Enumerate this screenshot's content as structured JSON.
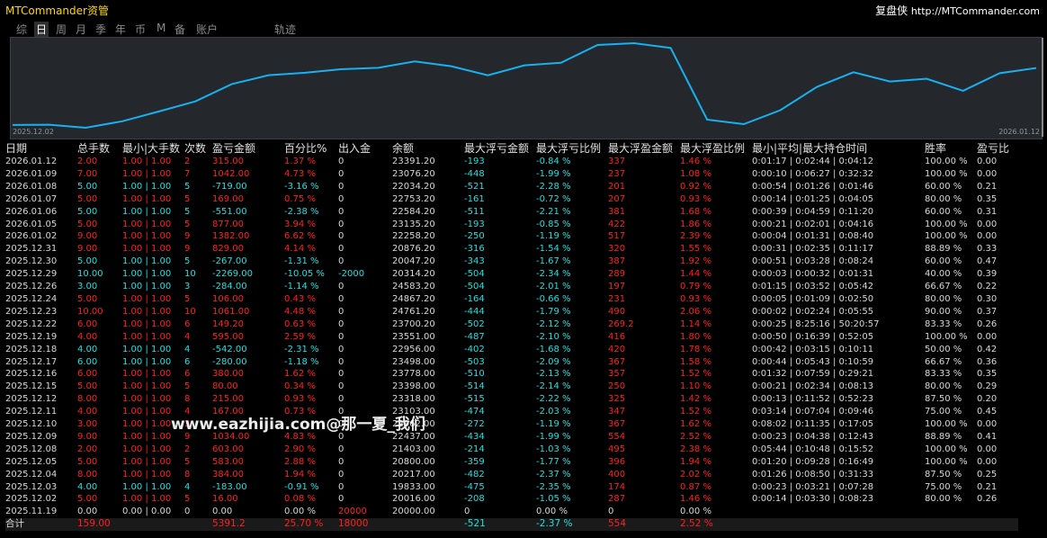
{
  "app": {
    "title": "MTCommander资管",
    "brand": "复盘侠",
    "url": "http://MTCommander.com"
  },
  "tabs": [
    "综",
    "日",
    "周",
    "月",
    "季",
    "年",
    "币",
    "M",
    "备",
    "账户",
    "轨迹"
  ],
  "active_tab": "日",
  "equity_chart": {
    "start_label": "2025.12.02",
    "end_label": "2026.01.12",
    "line_color": "#1ab0ef",
    "balances": [
      20000,
      20016,
      19833,
      20217,
      20800,
      21403,
      22437,
      22962,
      23103,
      23318,
      23398,
      23778,
      23498,
      22956,
      23551,
      23700,
      24761,
      24867,
      24583,
      20314,
      20047,
      20876,
      22258,
      23135,
      22584,
      22753,
      22034,
      23076,
      23391
    ]
  },
  "table": {
    "headers": [
      "日期",
      "总手数",
      "最小|大手数",
      "次数",
      "盈亏金额",
      "百分比%",
      "出入金",
      "余额",
      "最大浮亏金额",
      "最大浮亏比例",
      "最大浮盈金额",
      "最大浮盈比例",
      "最小|平均|最大持仓时间",
      "胜率",
      "盈亏比"
    ],
    "rows": [
      {
        "date": "2026.01.12",
        "lots": "2.00",
        "minmax": "1.00 | 1.00",
        "count": "2",
        "pnl": "315.00",
        "pct": "1.37 %",
        "flow": "0",
        "bal": "23391.20",
        "mfl": "-193",
        "mflp": "-0.84 %",
        "mfp": "337",
        "mfpp": "1.46 %",
        "time": "0:01:17 | 0:02:44 | 0:04:12",
        "win": "100.00 %",
        "pr": "0.00",
        "c": "R"
      },
      {
        "date": "2026.01.09",
        "lots": "7.00",
        "minmax": "1.00 | 1.00",
        "count": "7",
        "pnl": "1042.00",
        "pct": "4.73 %",
        "flow": "0",
        "bal": "23076.20",
        "mfl": "-448",
        "mflp": "-1.99 %",
        "mfp": "237",
        "mfpp": "1.08 %",
        "time": "0:00:10 | 0:06:27 | 0:32:32",
        "win": "100.00 %",
        "pr": "0.00",
        "c": "R"
      },
      {
        "date": "2026.01.08",
        "lots": "5.00",
        "minmax": "1.00 | 1.00",
        "count": "5",
        "pnl": "-719.00",
        "pct": "-3.16 %",
        "flow": "0",
        "bal": "22034.20",
        "mfl": "-521",
        "mflp": "-2.28 %",
        "mfp": "201",
        "mfpp": "0.92 %",
        "time": "0:00:54 | 0:01:26 | 0:01:46",
        "win": "60.00 %",
        "pr": "0.21",
        "c": "C"
      },
      {
        "date": "2026.01.07",
        "lots": "5.00",
        "minmax": "1.00 | 1.00",
        "count": "5",
        "pnl": "169.00",
        "pct": "0.75 %",
        "flow": "0",
        "bal": "22753.20",
        "mfl": "-161",
        "mflp": "-0.72 %",
        "mfp": "207",
        "mfpp": "0.93 %",
        "time": "0:00:14 | 0:01:25 | 0:04:05",
        "win": "80.00 %",
        "pr": "0.35",
        "c": "R"
      },
      {
        "date": "2026.01.06",
        "lots": "5.00",
        "minmax": "1.00 | 1.00",
        "count": "5",
        "pnl": "-551.00",
        "pct": "-2.38 %",
        "flow": "0",
        "bal": "22584.20",
        "mfl": "-511",
        "mflp": "-2.21 %",
        "mfp": "381",
        "mfpp": "1.68 %",
        "time": "0:00:39 | 0:04:59 | 0:11:20",
        "win": "60.00 %",
        "pr": "0.31",
        "c": "C"
      },
      {
        "date": "2026.01.05",
        "lots": "5.00",
        "minmax": "1.00 | 1.00",
        "count": "5",
        "pnl": "877.00",
        "pct": "3.94 %",
        "flow": "0",
        "bal": "23135.20",
        "mfl": "-193",
        "mflp": "-0.85 %",
        "mfp": "422",
        "mfpp": "1.86 %",
        "time": "0:00:21 | 0:02:01 | 0:04:16",
        "win": "100.00 %",
        "pr": "0.00",
        "c": "R"
      },
      {
        "date": "2026.01.02",
        "lots": "9.00",
        "minmax": "1.00 | 1.00",
        "count": "9",
        "pnl": "1382.00",
        "pct": "6.62 %",
        "flow": "0",
        "bal": "22258.20",
        "mfl": "-250",
        "mflp": "-1.19 %",
        "mfp": "517",
        "mfpp": "2.39 %",
        "time": "0:00:04 | 0:01:31 | 0:08:40",
        "win": "100.00 %",
        "pr": "0.00",
        "c": "R"
      },
      {
        "date": "2025.12.31",
        "lots": "9.00",
        "minmax": "1.00 | 1.00",
        "count": "9",
        "pnl": "829.00",
        "pct": "4.14 %",
        "flow": "0",
        "bal": "20876.20",
        "mfl": "-316",
        "mflp": "-1.54 %",
        "mfp": "320",
        "mfpp": "1.55 %",
        "time": "0:00:31 | 0:02:35 | 0:11:17",
        "win": "88.89 %",
        "pr": "0.33",
        "c": "R"
      },
      {
        "date": "2025.12.30",
        "lots": "5.00",
        "minmax": "1.00 | 1.00",
        "count": "5",
        "pnl": "-267.00",
        "pct": "-1.31 %",
        "flow": "0",
        "bal": "20047.20",
        "mfl": "-343",
        "mflp": "-1.67 %",
        "mfp": "387",
        "mfpp": "1.92 %",
        "time": "0:00:51 | 0:03:28 | 0:08:24",
        "win": "60.00 %",
        "pr": "0.47",
        "c": "C"
      },
      {
        "date": "2025.12.29",
        "lots": "10.00",
        "minmax": "1.00 | 1.00",
        "count": "10",
        "pnl": "-2269.00",
        "pct": "-10.05 %",
        "flow": "-2000",
        "bal": "20314.20",
        "mfl": "-504",
        "mflp": "-2.34 %",
        "mfp": "289",
        "mfpp": "1.44 %",
        "time": "0:00:03 | 0:00:32 | 0:01:31",
        "win": "40.00 %",
        "pr": "0.39",
        "c": "C"
      },
      {
        "date": "2025.12.26",
        "lots": "3.00",
        "minmax": "1.00 | 1.00",
        "count": "3",
        "pnl": "-284.00",
        "pct": "-1.14 %",
        "flow": "0",
        "bal": "24583.20",
        "mfl": "-504",
        "mflp": "-2.01 %",
        "mfp": "197",
        "mfpp": "0.79 %",
        "time": "0:01:15 | 0:03:52 | 0:05:42",
        "win": "66.67 %",
        "pr": "0.22",
        "c": "C"
      },
      {
        "date": "2025.12.24",
        "lots": "5.00",
        "minmax": "1.00 | 1.00",
        "count": "5",
        "pnl": "106.00",
        "pct": "0.43 %",
        "flow": "0",
        "bal": "24867.20",
        "mfl": "-164",
        "mflp": "-0.66 %",
        "mfp": "231",
        "mfpp": "0.93 %",
        "time": "0:00:05 | 0:01:09 | 0:02:50",
        "win": "80.00 %",
        "pr": "0.30",
        "c": "R"
      },
      {
        "date": "2025.12.23",
        "lots": "10.00",
        "minmax": "1.00 | 1.00",
        "count": "10",
        "pnl": "1061.00",
        "pct": "4.48 %",
        "flow": "0",
        "bal": "24761.20",
        "mfl": "-444",
        "mflp": "-1.79 %",
        "mfp": "490",
        "mfpp": "2.06 %",
        "time": "0:00:02 | 0:02:24 | 0:05:55",
        "win": "90.00 %",
        "pr": "0.37",
        "c": "R"
      },
      {
        "date": "2025.12.22",
        "lots": "6.00",
        "minmax": "1.00 | 1.00",
        "count": "6",
        "pnl": "149.20",
        "pct": "0.63 %",
        "flow": "0",
        "bal": "23700.20",
        "mfl": "-502",
        "mflp": "-2.12 %",
        "mfp": "269.2",
        "mfpp": "1.14 %",
        "time": "0:00:25 | 8:25:16 | 50:20:57",
        "win": "83.33 %",
        "pr": "0.26",
        "c": "R"
      },
      {
        "date": "2025.12.19",
        "lots": "4.00",
        "minmax": "1.00 | 1.00",
        "count": "4",
        "pnl": "595.00",
        "pct": "2.59 %",
        "flow": "0",
        "bal": "23551.00",
        "mfl": "-487",
        "mflp": "-2.10 %",
        "mfp": "416",
        "mfpp": "1.80 %",
        "time": "0:00:50 | 0:16:39 | 0:52:05",
        "win": "100.00 %",
        "pr": "0.00",
        "c": "R"
      },
      {
        "date": "2025.12.18",
        "lots": "4.00",
        "minmax": "1.00 | 1.00",
        "count": "4",
        "pnl": "-542.00",
        "pct": "-2.31 %",
        "flow": "0",
        "bal": "22956.00",
        "mfl": "-402",
        "mflp": "-1.68 %",
        "mfp": "420",
        "mfpp": "1.78 %",
        "time": "0:00:42 | 0:03:15 | 0:10:11",
        "win": "50.00 %",
        "pr": "0.42",
        "c": "C"
      },
      {
        "date": "2025.12.17",
        "lots": "6.00",
        "minmax": "1.00 | 1.00",
        "count": "6",
        "pnl": "-280.00",
        "pct": "-1.18 %",
        "flow": "0",
        "bal": "23498.00",
        "mfl": "-503",
        "mflp": "-2.09 %",
        "mfp": "367",
        "mfpp": "1.58 %",
        "time": "0:00:44 | 0:05:43 | 0:10:59",
        "win": "66.67 %",
        "pr": "0.36",
        "c": "C"
      },
      {
        "date": "2025.12.16",
        "lots": "6.00",
        "minmax": "1.00 | 1.00",
        "count": "6",
        "pnl": "380.00",
        "pct": "1.62 %",
        "flow": "0",
        "bal": "23778.00",
        "mfl": "-510",
        "mflp": "-2.13 %",
        "mfp": "357",
        "mfpp": "1.52 %",
        "time": "0:01:32 | 0:07:59 | 0:29:21",
        "win": "83.33 %",
        "pr": "0.35",
        "c": "R"
      },
      {
        "date": "2025.12.15",
        "lots": "5.00",
        "minmax": "1.00 | 1.00",
        "count": "5",
        "pnl": "80.00",
        "pct": "0.34 %",
        "flow": "0",
        "bal": "23398.00",
        "mfl": "-514",
        "mflp": "-2.14 %",
        "mfp": "250",
        "mfpp": "1.10 %",
        "time": "0:00:21 | 0:02:34 | 0:08:13",
        "win": "80.00 %",
        "pr": "0.29",
        "c": "R"
      },
      {
        "date": "2025.12.12",
        "lots": "8.00",
        "minmax": "1.00 | 1.00",
        "count": "8",
        "pnl": "215.00",
        "pct": "0.93 %",
        "flow": "0",
        "bal": "23318.00",
        "mfl": "-515",
        "mflp": "-2.22 %",
        "mfp": "325",
        "mfpp": "1.42 %",
        "time": "0:00:13 | 0:11:52 | 0:52:23",
        "win": "87.50 %",
        "pr": "0.20",
        "c": "R"
      },
      {
        "date": "2025.12.11",
        "lots": "4.00",
        "minmax": "1.00 | 1.00",
        "count": "4",
        "pnl": "167.00",
        "pct": "0.73 %",
        "flow": "0",
        "bal": "23103.00",
        "mfl": "-474",
        "mflp": "-2.03 %",
        "mfp": "347",
        "mfpp": "1.52 %",
        "time": "0:03:14 | 0:07:04 | 0:09:46",
        "win": "75.00 %",
        "pr": "0.45",
        "c": "R"
      },
      {
        "date": "2025.12.10",
        "lots": "3.00",
        "minmax": "1.00 | 1.00",
        "count": "3",
        "pnl": "",
        "pct": "",
        "flow": "0",
        "bal": "22962.00",
        "mfl": "-272",
        "mflp": "-1.19 %",
        "mfp": "367",
        "mfpp": "1.62 %",
        "time": "0:08:02 | 0:11:35 | 0:17:05",
        "win": "100.00 %",
        "pr": "0.00",
        "c": "R"
      },
      {
        "date": "2025.12.09",
        "lots": "9.00",
        "minmax": "1.00 | 1.00",
        "count": "9",
        "pnl": "1034.00",
        "pct": "4.83 %",
        "flow": "0",
        "bal": "22437.00",
        "mfl": "-434",
        "mflp": "-1.99 %",
        "mfp": "554",
        "mfpp": "2.52 %",
        "time": "0:00:23 | 0:04:38 | 0:12:43",
        "win": "88.89 %",
        "pr": "0.41",
        "c": "R"
      },
      {
        "date": "2025.12.08",
        "lots": "2.00",
        "minmax": "1.00 | 1.00",
        "count": "2",
        "pnl": "603.00",
        "pct": "2.90 %",
        "flow": "0",
        "bal": "21403.00",
        "mfl": "-214",
        "mflp": "-1.03 %",
        "mfp": "495",
        "mfpp": "2.38 %",
        "time": "0:05:44 | 0:10:48 | 0:15:52",
        "win": "100.00 %",
        "pr": "0.00",
        "c": "R"
      },
      {
        "date": "2025.12.05",
        "lots": "5.00",
        "minmax": "1.00 | 1.00",
        "count": "5",
        "pnl": "583.00",
        "pct": "2.88 %",
        "flow": "0",
        "bal": "20800.00",
        "mfl": "-359",
        "mflp": "-1.77 %",
        "mfp": "396",
        "mfpp": "1.94 %",
        "time": "0:01:20 | 0:09:28 | 0:16:49",
        "win": "100.00 %",
        "pr": "0.00",
        "c": "R"
      },
      {
        "date": "2025.12.04",
        "lots": "8.00",
        "minmax": "1.00 | 1.00",
        "count": "8",
        "pnl": "384.00",
        "pct": "1.94 %",
        "flow": "0",
        "bal": "20217.00",
        "mfl": "-482",
        "mflp": "-2.37 %",
        "mfp": "400",
        "mfpp": "2.02 %",
        "time": "0:01:26 | 0:08:50 | 0:31:33",
        "win": "87.50 %",
        "pr": "0.25",
        "c": "R"
      },
      {
        "date": "2025.12.03",
        "lots": "4.00",
        "minmax": "1.00 | 1.00",
        "count": "4",
        "pnl": "-183.00",
        "pct": "-0.91 %",
        "flow": "0",
        "bal": "19833.00",
        "mfl": "-475",
        "mflp": "-2.35 %",
        "mfp": "174",
        "mfpp": "0.87 %",
        "time": "0:00:23 | 0:03:21 | 0:07:28",
        "win": "75.00 %",
        "pr": "0.21",
        "c": "C"
      },
      {
        "date": "2025.12.02",
        "lots": "5.00",
        "minmax": "1.00 | 1.00",
        "count": "5",
        "pnl": "16.00",
        "pct": "0.08 %",
        "flow": "0",
        "bal": "20016.00",
        "mfl": "-208",
        "mflp": "-1.05 %",
        "mfp": "287",
        "mfpp": "1.46 %",
        "time": "0:00:14 | 0:03:30 | 0:08:23",
        "win": "80.00 %",
        "pr": "0.26",
        "c": "R"
      },
      {
        "date": "2025.11.19",
        "lots": "0.00",
        "minmax": "0.00 | 0.00",
        "count": "0",
        "pnl": "0.00",
        "pct": "0.00 %",
        "flow": "20000",
        "bal": "20000.00",
        "mfl": "0",
        "mflp": "0.00 %",
        "mfp": "0",
        "mfpp": "0.00 %",
        "time": "",
        "win": "",
        "pr": "",
        "c": "W"
      }
    ],
    "total": {
      "label": "合计",
      "lots": "159.00",
      "pnl": "5391.2",
      "pct": "25.70 %",
      "flow": "18000",
      "mfl": "-521",
      "mflp": "-2.37 %",
      "mfp": "554",
      "mfpp": "2.52 %"
    }
  },
  "watermark": "www.eazhijia.com@那一夏_我们"
}
